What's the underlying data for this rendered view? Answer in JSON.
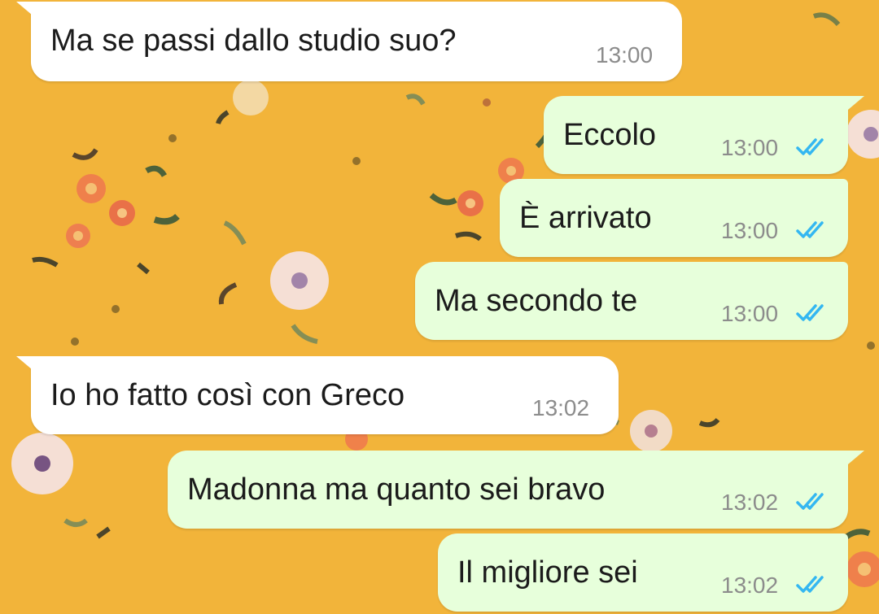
{
  "chat": {
    "messages": [
      {
        "direction": "incoming",
        "text": "Ma se passi dallo studio suo?",
        "time": "13:00"
      },
      {
        "direction": "outgoing",
        "text": "Eccolo",
        "time": "13:00",
        "status_icon": "double-check-read-icon"
      },
      {
        "direction": "outgoing",
        "text": "È arrivato",
        "time": "13:00",
        "status_icon": "double-check-read-icon"
      },
      {
        "direction": "outgoing",
        "text": "Ma secondo te",
        "time": "13:00",
        "status_icon": "double-check-read-icon"
      },
      {
        "direction": "incoming",
        "text": "Io ho fatto così con Greco",
        "time": "13:02"
      },
      {
        "direction": "outgoing",
        "text": "Madonna ma quanto sei bravo",
        "time": "13:02",
        "status_icon": "double-check-read-icon"
      },
      {
        "direction": "outgoing",
        "text": "Il migliore sei",
        "time": "13:02",
        "status_icon": "double-check-read-icon"
      }
    ]
  },
  "colors": {
    "wallpaper": "#f2b43a",
    "incoming_bubble": "#ffffff",
    "outgoing_bubble": "#e7ffdb",
    "read_tick": "#34b7f1",
    "timestamp": "#8c8c8c"
  }
}
